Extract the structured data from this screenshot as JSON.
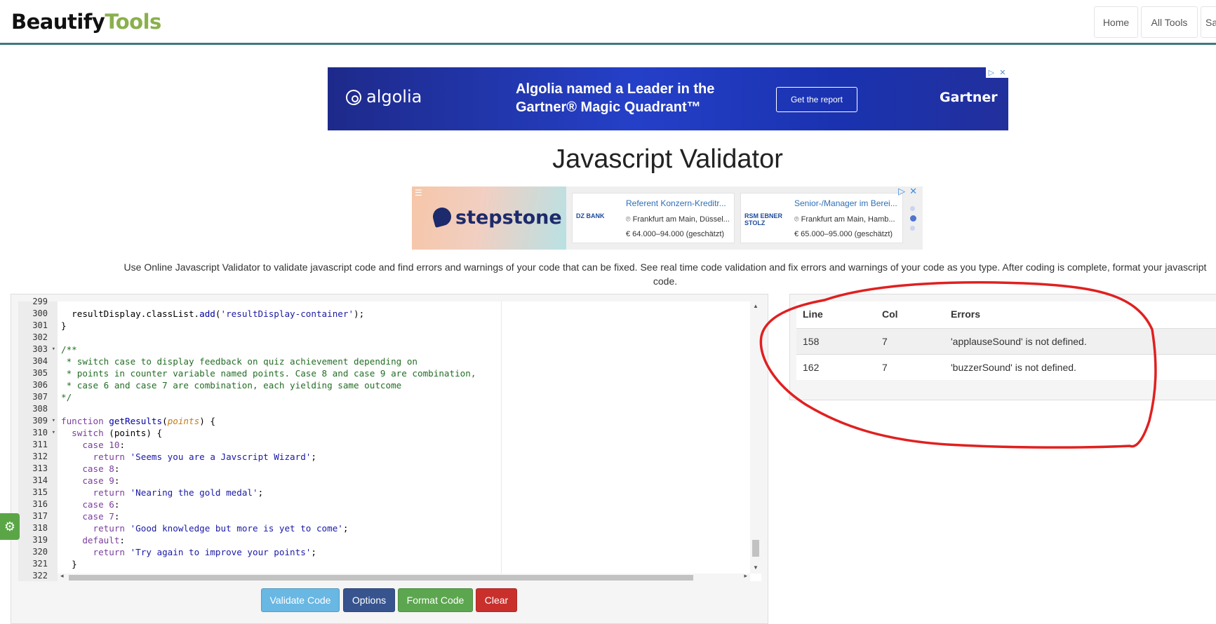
{
  "header": {
    "logo_part1": "Beautify",
    "logo_part2": "Tools",
    "nav": [
      "Home",
      "All Tools",
      "Sa"
    ]
  },
  "ad_banner": {
    "brand": "algolia",
    "headline": "Algolia named a Leader in the Gartner® Magic Quadrant™",
    "cta": "Get the report",
    "partner": "Gartner"
  },
  "page_title": "Javascript Validator",
  "job_ad": {
    "brand": "stepstone",
    "jobs": [
      {
        "company": "DZ BANK",
        "title": "Referent Konzern-Kreditr...",
        "location": "Frankfurt am Main, Düssel...",
        "salary": "€ 64.000–94.000 (geschätzt)"
      },
      {
        "company": "RSM EBNER STOLZ",
        "title": "Senior-/Manager im Berei...",
        "location": "Frankfurt am Main, Hamb...",
        "salary": "€ 65.000–95.000 (geschätzt)"
      }
    ]
  },
  "description": "Use Online Javascript Validator to validate javascript code and find errors and warnings of your code that can be fixed. See real time code validation and fix errors and warnings of your code as you type. After coding is complete, format your javascript code.",
  "editor": {
    "gutter": [
      {
        "n": "299",
        "fold": false
      },
      {
        "n": "300",
        "fold": false
      },
      {
        "n": "301",
        "fold": false
      },
      {
        "n": "302",
        "fold": false
      },
      {
        "n": "303",
        "fold": true
      },
      {
        "n": "304",
        "fold": false
      },
      {
        "n": "305",
        "fold": false
      },
      {
        "n": "306",
        "fold": false
      },
      {
        "n": "307",
        "fold": false
      },
      {
        "n": "308",
        "fold": false
      },
      {
        "n": "309",
        "fold": true
      },
      {
        "n": "310",
        "fold": true
      },
      {
        "n": "311",
        "fold": false
      },
      {
        "n": "312",
        "fold": false
      },
      {
        "n": "313",
        "fold": false
      },
      {
        "n": "314",
        "fold": false
      },
      {
        "n": "315",
        "fold": false
      },
      {
        "n": "316",
        "fold": false
      },
      {
        "n": "317",
        "fold": false
      },
      {
        "n": "318",
        "fold": false
      },
      {
        "n": "319",
        "fold": false
      },
      {
        "n": "320",
        "fold": false
      },
      {
        "n": "321",
        "fold": false
      },
      {
        "n": "322",
        "fold": false
      }
    ],
    "lines": [
      [
        [
          "",
          "  resultDisplay.classList."
        ],
        [
          "fn",
          "add"
        ],
        [
          "",
          "("
        ],
        [
          "str",
          "'resultDisplay-container'"
        ],
        [
          "",
          ");"
        ]
      ],
      [
        [
          "",
          "}"
        ]
      ],
      [
        [
          "",
          ""
        ]
      ],
      [
        [
          "cm",
          "/**"
        ]
      ],
      [
        [
          "cm",
          " * switch case to display feedback on quiz achievement depending on"
        ]
      ],
      [
        [
          "cm",
          " * points in counter variable named points. Case 8 and case 9 are combination,"
        ]
      ],
      [
        [
          "cm",
          " * case 6 and case 7 are combination, each yielding same outcome"
        ]
      ],
      [
        [
          "cm",
          "*/"
        ]
      ],
      [
        [
          "",
          ""
        ]
      ],
      [
        [
          "kw",
          "function"
        ],
        [
          "",
          " "
        ],
        [
          "fn",
          "getResults"
        ],
        [
          "",
          "("
        ],
        [
          "prm",
          "points"
        ],
        [
          "",
          ") {"
        ]
      ],
      [
        [
          "",
          "  "
        ],
        [
          "kw",
          "switch"
        ],
        [
          "",
          " (points) {"
        ]
      ],
      [
        [
          "",
          "    "
        ],
        [
          "kw",
          "case"
        ],
        [
          "",
          " "
        ],
        [
          "kw",
          "10"
        ],
        [
          "",
          ":"
        ]
      ],
      [
        [
          "",
          "      "
        ],
        [
          "kw",
          "return"
        ],
        [
          "",
          " "
        ],
        [
          "str",
          "'Seems you are a Javscript Wizard'"
        ],
        [
          "",
          ";"
        ]
      ],
      [
        [
          "",
          "    "
        ],
        [
          "kw",
          "case"
        ],
        [
          "",
          " "
        ],
        [
          "kw",
          "8"
        ],
        [
          "",
          ":"
        ]
      ],
      [
        [
          "",
          "    "
        ],
        [
          "kw",
          "case"
        ],
        [
          "",
          " "
        ],
        [
          "kw",
          "9"
        ],
        [
          "",
          ":"
        ]
      ],
      [
        [
          "",
          "      "
        ],
        [
          "kw",
          "return"
        ],
        [
          "",
          " "
        ],
        [
          "str",
          "'Nearing the gold medal'"
        ],
        [
          "",
          ";"
        ]
      ],
      [
        [
          "",
          "    "
        ],
        [
          "kw",
          "case"
        ],
        [
          "",
          " "
        ],
        [
          "kw",
          "6"
        ],
        [
          "",
          ":"
        ]
      ],
      [
        [
          "",
          "    "
        ],
        [
          "kw",
          "case"
        ],
        [
          "",
          " "
        ],
        [
          "kw",
          "7"
        ],
        [
          "",
          ":"
        ]
      ],
      [
        [
          "",
          "      "
        ],
        [
          "kw",
          "return"
        ],
        [
          "",
          " "
        ],
        [
          "str",
          "'Good knowledge but more is yet to come'"
        ],
        [
          "",
          ";"
        ]
      ],
      [
        [
          "",
          "    "
        ],
        [
          "kw",
          "default"
        ],
        [
          "",
          ":"
        ]
      ],
      [
        [
          "",
          "      "
        ],
        [
          "kw",
          "return"
        ],
        [
          "",
          " "
        ],
        [
          "str",
          "'Try again to improve your points'"
        ],
        [
          "",
          ";"
        ]
      ],
      [
        [
          "",
          "  }"
        ]
      ]
    ]
  },
  "buttons": {
    "validate": "Validate Code",
    "options": "Options",
    "format": "Format Code",
    "clear": "Clear"
  },
  "errors": {
    "headers": [
      "Line",
      "Col",
      "Errors"
    ],
    "rows": [
      {
        "line": "158",
        "col": "7",
        "msg": "'applauseSound' is not defined."
      },
      {
        "line": "162",
        "col": "7",
        "msg": "'buzzerSound' is not defined."
      }
    ]
  },
  "colors": {
    "accent_green": "#8ab04b",
    "header_border": "#3d7a7a",
    "annotation": "#e02020"
  }
}
